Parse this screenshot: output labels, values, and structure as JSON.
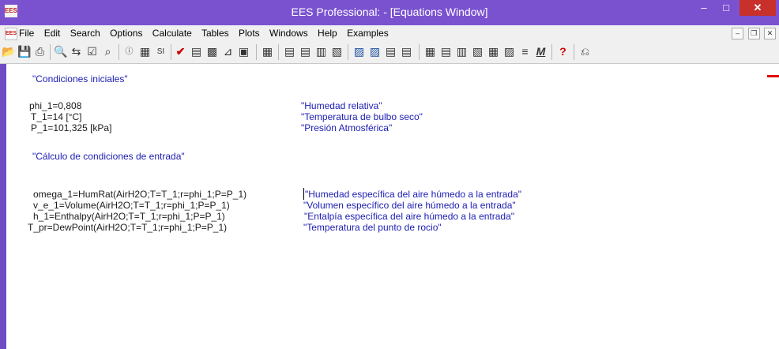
{
  "window": {
    "logo_text": "EES",
    "title": "EES Professional:  - [Equations Window]",
    "minimize_glyph": "–",
    "maximize_glyph": "□",
    "close_glyph": "✕"
  },
  "menu": {
    "logo_text": "EES",
    "items": [
      "File",
      "Edit",
      "Search",
      "Options",
      "Calculate",
      "Tables",
      "Plots",
      "Windows",
      "Help",
      "Examples"
    ],
    "mdi_minimize": "–",
    "mdi_restore": "❐",
    "mdi_close": "✕"
  },
  "toolbar": {
    "icons": [
      "open-folder-icon",
      "save-icon",
      "print-icon",
      "find-icon",
      "replace-icon",
      "check-icon",
      "magnify-icon",
      "info-icon",
      "variable-info-icon",
      "unit-system-icon",
      "solve-check-icon",
      "calculator-icon",
      "plot-icon",
      "plot-window-icon",
      "diagram-icon",
      "table-icon",
      "lookup-table-icon",
      "chart-icon",
      "array-icon",
      "new-plot-icon",
      "formatted-equations-icon",
      "parametric-table-icon",
      "table-window-icon",
      "array-window-icon",
      "grid-icon",
      "list-icon",
      "calc-table-icon",
      "property-plot-icon",
      "new-table-icon",
      "lookup-icon",
      "units-icon",
      "solve-icon",
      "help-icon",
      "exit-icon"
    ]
  },
  "equations": {
    "header_comment": "\"Condiciones iniciales\"",
    "initial": [
      {
        "eq": "phi_1=0,808",
        "comment": "\"Humedad relativa\""
      },
      {
        "eq": "T_1=14 [°C]",
        "comment": "\"Temperatura de bulbo seco\""
      },
      {
        "eq": "P_1=101,325 [kPa]",
        "comment": "\"Presión Atmosférica\""
      }
    ],
    "section_comment": "\"Cálculo de condiciones de entrada\"",
    "calcs": [
      {
        "eq": "omega_1=HumRat(AirH2O;T=T_1;r=phi_1;P=P_1)",
        "comment": "\"Humedad específica del aire húmedo a la entrada\""
      },
      {
        "eq": "v_e_1=Volume(AirH2O;T=T_1;r=phi_1;P=P_1)",
        "comment": "\"Volumen específico del aire húmedo a la entrada\""
      },
      {
        "eq": "h_1=Enthalpy(AirH2O;T=T_1;r=phi_1;P=P_1)",
        "comment": "\"Entalpía específica del aire húmedo a la entrada\""
      },
      {
        "eq": "T_pr=DewPoint(AirH2O;T=T_1;r=phi_1;P=P_1)",
        "comment": "\"Temperatura del punto de rocio\""
      }
    ]
  }
}
